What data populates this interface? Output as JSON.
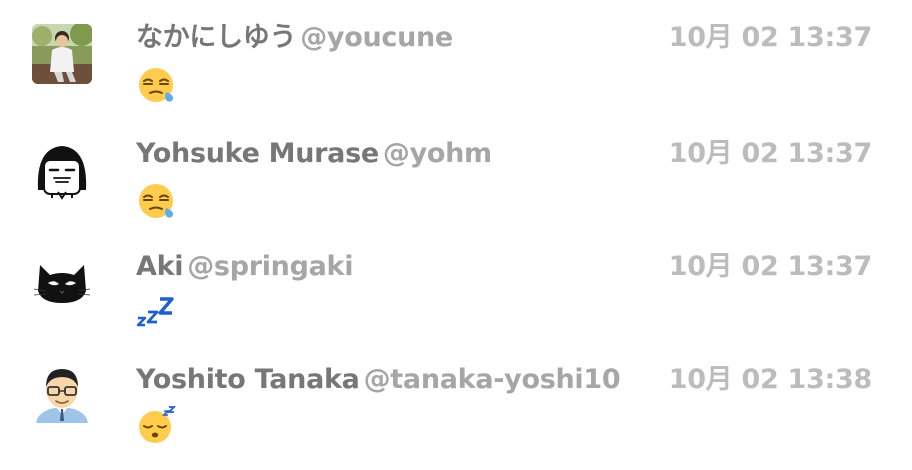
{
  "messages": [
    {
      "display_name": "なかにしゆう",
      "handle": "@youcune",
      "timestamp": "10月 02 13:37",
      "avatar_icon": "photo-avatar-icon",
      "emoji_icon": "sleepy-face-emoji-icon"
    },
    {
      "display_name": "Yohsuke Murase",
      "handle": "@yohm",
      "timestamp": "10月 02 13:37",
      "avatar_icon": "drawn-face-avatar-icon",
      "emoji_icon": "sleepy-face-emoji-icon"
    },
    {
      "display_name": "Aki",
      "handle": "@springaki",
      "timestamp": "10月 02 13:37",
      "avatar_icon": "black-cat-avatar-icon",
      "emoji_icon": "zzz-emoji-icon"
    },
    {
      "display_name": "Yoshito Tanaka",
      "handle": "@tanaka-yoshi10",
      "timestamp": "10月 02 13:38",
      "avatar_icon": "glasses-man-avatar-icon",
      "emoji_icon": "sleeping-face-emoji-icon"
    }
  ]
}
